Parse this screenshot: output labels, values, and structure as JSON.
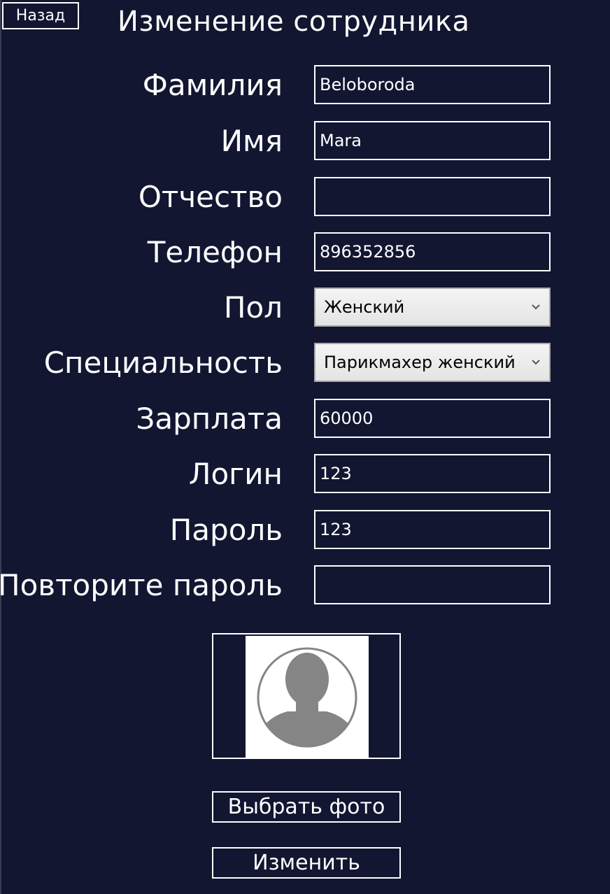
{
  "header": {
    "back_label": "Назад",
    "title": "Изменение сотрудника"
  },
  "form": {
    "fields": [
      {
        "label": "Фамилия",
        "value": "Beloboroda"
      },
      {
        "label": "Имя",
        "value": "Mara"
      },
      {
        "label": "Отчество",
        "value": ""
      },
      {
        "label": "Телефон",
        "value": "896352856"
      },
      {
        "label": "Пол",
        "value": "Женский"
      },
      {
        "label": "Специальность",
        "value": "Парикмахер женский"
      },
      {
        "label": "Зарплата",
        "value": "60000"
      },
      {
        "label": "Логин",
        "value": "123"
      },
      {
        "label": "Пароль",
        "value": "123"
      },
      {
        "label": "Повторите пароль",
        "value": ""
      }
    ]
  },
  "photo": {
    "icon": "user-placeholder-icon",
    "choose_label": "Выбрать фото"
  },
  "actions": {
    "submit_label": "Изменить"
  },
  "colors": {
    "background": "#121631",
    "foreground": "#ffffff",
    "avatar_gray": "#858585"
  }
}
